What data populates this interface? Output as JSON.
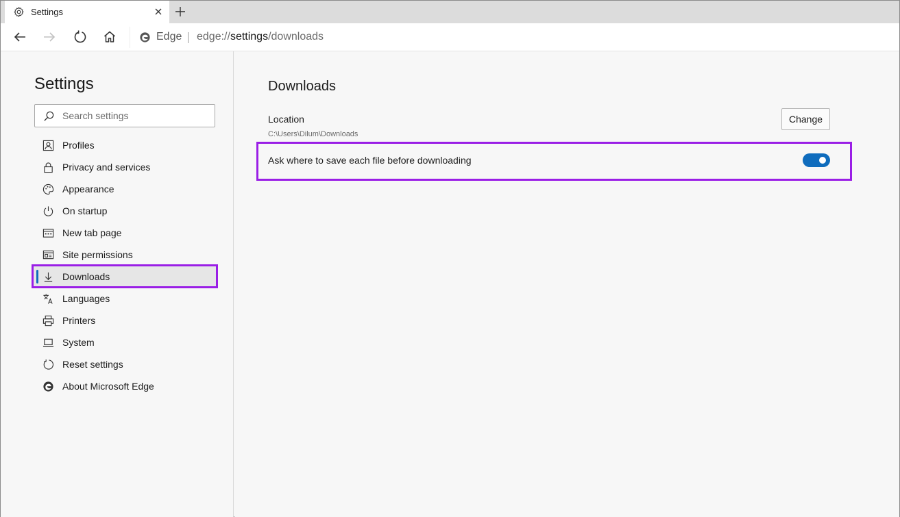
{
  "tab": {
    "title": "Settings"
  },
  "toolbar": {
    "site_label": "Edge",
    "url_prefix": "edge://",
    "url_host": "settings",
    "url_path": "/downloads"
  },
  "sidebar": {
    "title": "Settings",
    "search_placeholder": "Search settings",
    "items": [
      {
        "label": "Profiles",
        "icon": "profile-icon"
      },
      {
        "label": "Privacy and services",
        "icon": "lock-icon"
      },
      {
        "label": "Appearance",
        "icon": "palette-icon"
      },
      {
        "label": "On startup",
        "icon": "power-icon"
      },
      {
        "label": "New tab page",
        "icon": "new-tab-page-icon"
      },
      {
        "label": "Site permissions",
        "icon": "site-permissions-icon"
      },
      {
        "label": "Downloads",
        "icon": "download-icon",
        "active": true
      },
      {
        "label": "Languages",
        "icon": "languages-icon"
      },
      {
        "label": "Printers",
        "icon": "printer-icon"
      },
      {
        "label": "System",
        "icon": "laptop-icon"
      },
      {
        "label": "Reset settings",
        "icon": "reset-icon"
      },
      {
        "label": "About Microsoft Edge",
        "icon": "edge-logo-icon"
      }
    ]
  },
  "main": {
    "title": "Downloads",
    "location_label": "Location",
    "location_path": "C:\\Users\\Dilum\\Downloads",
    "change_label": "Change",
    "ask_label": "Ask where to save each file before downloading",
    "ask_enabled": true
  },
  "colors": {
    "accent": "#0f6cbd",
    "highlight": "#9a1ee6"
  }
}
